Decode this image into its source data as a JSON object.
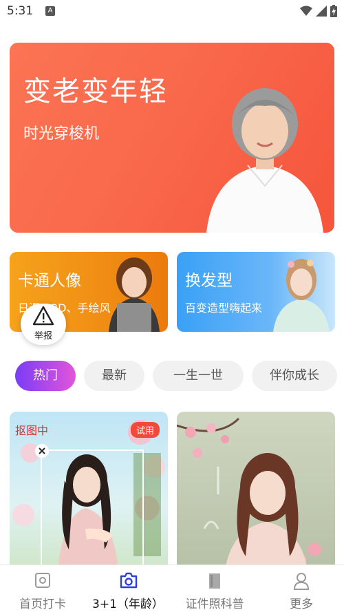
{
  "status_bar": {
    "time": "5:31",
    "notification_icon": "a-notification-icon",
    "signal": "signal-icon",
    "battery": "battery-charging-icon"
  },
  "banner": {
    "title": "变老变年轻",
    "subtitle": "时光穿梭机"
  },
  "feature_cards": [
    {
      "title": "卡通人像",
      "subtitle": "日漫、3D、手绘风"
    },
    {
      "title": "换发型",
      "subtitle": "百变造型嗨起来"
    }
  ],
  "report_button": {
    "label": "举报",
    "icon": "warning-triangle-icon"
  },
  "category_tabs": [
    "热门",
    "最新",
    "一生一世",
    "伴你成长"
  ],
  "active_tab": "热门",
  "photos": {
    "left": {
      "status": "抠图中",
      "badge": "试用"
    }
  },
  "bottom_nav": [
    {
      "label": "首页打卡",
      "icon": "camera-square-icon",
      "active": false
    },
    {
      "label": "3+1（年龄）",
      "icon": "camera-icon",
      "active": true
    },
    {
      "label": "证件照科普",
      "icon": "book-icon",
      "active": false
    },
    {
      "label": "更多",
      "icon": "user-icon",
      "active": false
    }
  ],
  "colors": {
    "banner": "#f9674a",
    "cartoon_card": "#f08d14",
    "hair_card": "#3aa0f5",
    "active_tab_start": "#7b3cf7",
    "active_tab_end": "#e255d9",
    "nav_active": "#2d3fd9"
  }
}
